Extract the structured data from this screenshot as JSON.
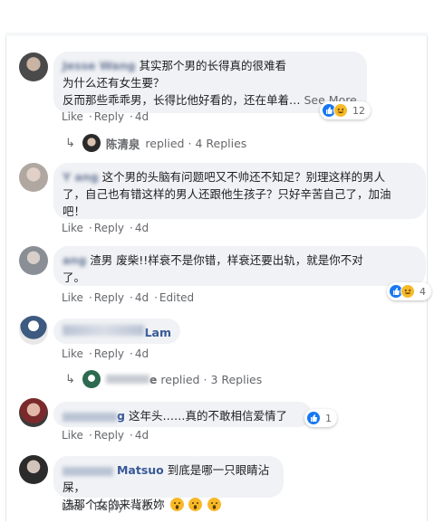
{
  "comments": [
    {
      "name": "Jesse Wang",
      "text_lines": [
        "其实那个男的长得真的很难看",
        "为什么还有女生要？",
        "反而那些乖乖男，长得比他好看的，还在单着…"
      ],
      "see_more": "See More",
      "actions": [
        "Like",
        "Reply",
        "4d"
      ],
      "reaction_count": "12",
      "reactions": [
        "like-icon",
        "haha-icon"
      ],
      "replies": {
        "name": "陈清泉",
        "label": "replied",
        "count": "4 Replies"
      }
    },
    {
      "name": "Y ang",
      "text_lines": [
        "这个男的头脑有问题吧又不帅还不知足？别理这样的男人",
        "了，自己也有错这样的男人还跟他生孩子？只好辛苦自己了，加油",
        "吧！"
      ],
      "actions": [
        "Like",
        "Reply",
        "4d"
      ]
    },
    {
      "name": "ang",
      "text_lines": [
        "渣男 废柴!!样衰不是你错，样衰还要出轨，就是你不对",
        "了。"
      ],
      "actions": [
        "Like",
        "Reply",
        "4d",
        "Edited"
      ],
      "reaction_count": "4",
      "reactions": [
        "like-icon",
        "haha-icon"
      ]
    },
    {
      "name": "Lam",
      "text_lines": [],
      "actions": [
        "Like",
        "Reply",
        "4d"
      ],
      "replies": {
        "name": "e",
        "label": "replied",
        "count": "3 Replies"
      }
    },
    {
      "name": "g",
      "text_lines": [
        "这年头……真的不敢相信爱情了"
      ],
      "actions": [
        "Like",
        "Reply",
        "4d"
      ],
      "reaction_count": "1",
      "reactions": [
        "like-icon"
      ]
    },
    {
      "name": "Matsuo",
      "text_lines": [
        "到底是哪一只眼睛沾屎，",
        "选那个女的来背叛妳"
      ],
      "actions": [
        "Like",
        "Reply",
        "4d"
      ],
      "inline_emojis": [
        "wow-icon",
        "wow-icon",
        "wow-icon"
      ]
    }
  ]
}
